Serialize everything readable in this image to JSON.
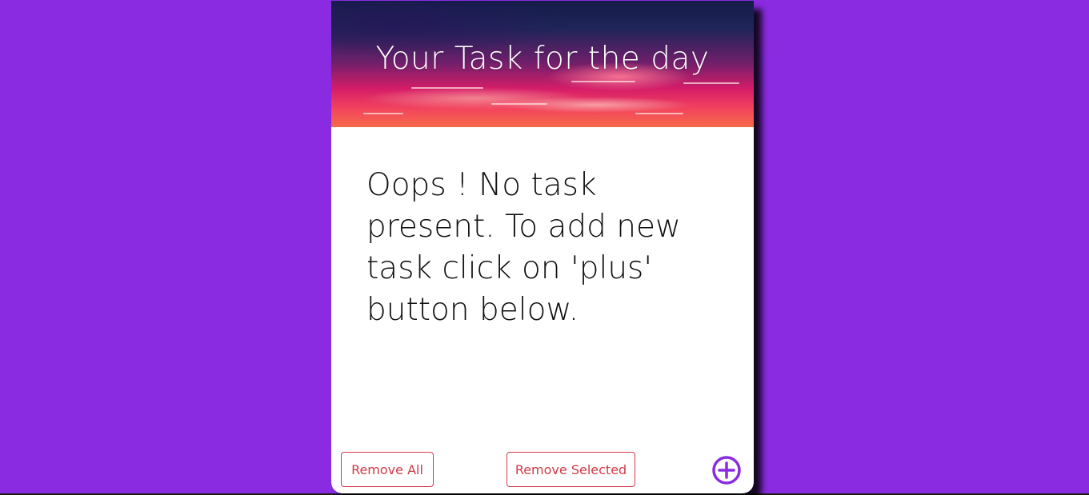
{
  "header": {
    "title": "Your Task for the day"
  },
  "empty_state": {
    "message": "Oops ! No task present. To add new task click on 'plus' button below."
  },
  "footer": {
    "remove_all_label": "Remove All",
    "remove_selected_label": "Remove Selected",
    "add_icon": "plus-circle-icon"
  },
  "colors": {
    "page_background": "#8a2be2",
    "card_background": "#ffffff",
    "button_accent": "#d13a47",
    "add_icon_color": "#8a2be2"
  }
}
